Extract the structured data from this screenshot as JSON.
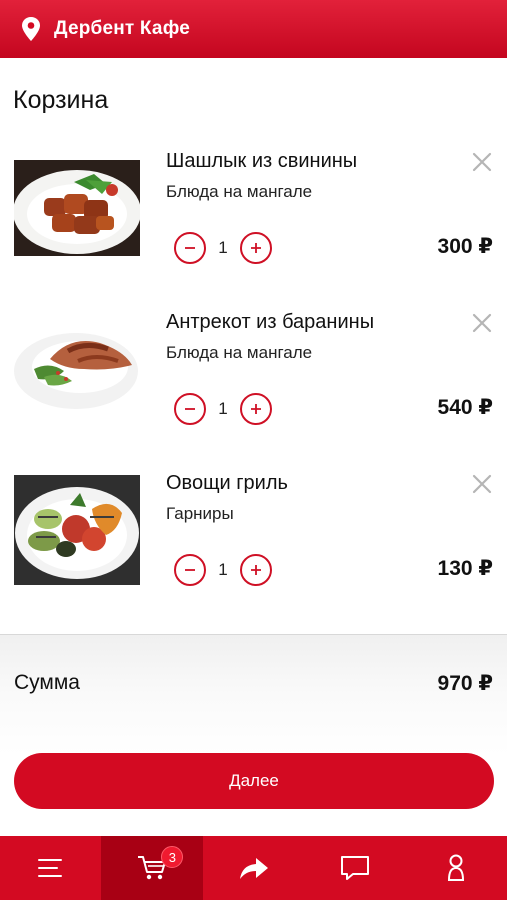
{
  "header": {
    "title": "Дербент Кафе",
    "icon": "location-pin-icon"
  },
  "page_title": "Корзина",
  "cart": {
    "items": [
      {
        "name": "Шашлык из свинины",
        "category": "Блюда на мангале",
        "quantity": "1",
        "price": "300 ₽",
        "image": "pork-shashlik-photo"
      },
      {
        "name": "Антрекот из баранины",
        "category": "Блюда на мангале",
        "quantity": "1",
        "price": "540 ₽",
        "image": "lamb-entrecote-photo"
      },
      {
        "name": "Овощи гриль",
        "category": "Гарниры",
        "quantity": "1",
        "price": "130 ₽",
        "image": "grilled-vegetables-photo"
      }
    ]
  },
  "summary": {
    "label": "Сумма",
    "value": "970 ₽"
  },
  "next_button": "Далее",
  "tabbar": {
    "tabs": [
      {
        "icon": "menu-icon"
      },
      {
        "icon": "cart-icon",
        "badge": "3",
        "active": true
      },
      {
        "icon": "share-icon"
      },
      {
        "icon": "chat-icon"
      },
      {
        "icon": "profile-icon"
      }
    ]
  },
  "colors": {
    "brand": "#d30a22",
    "active_tab": "#a80014",
    "text": "#111111"
  }
}
